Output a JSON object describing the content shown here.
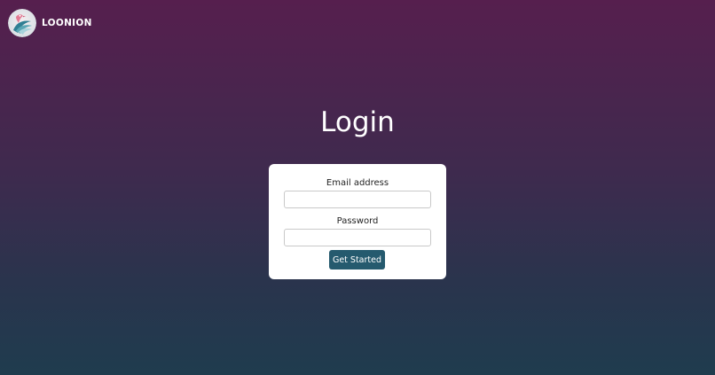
{
  "brand": {
    "name": "LOONION",
    "logo_icon": "loonion-bird-logo-icon"
  },
  "page": {
    "title": "Login"
  },
  "form": {
    "email_label": "Email address",
    "email_value": "",
    "email_placeholder": "",
    "password_label": "Password",
    "password_value": "",
    "password_placeholder": "",
    "submit_label": "Get Started"
  },
  "colors": {
    "background_top": "#561f4e",
    "background_bottom": "#1f3c4e",
    "button": "#255a6e",
    "card": "#ffffff"
  }
}
